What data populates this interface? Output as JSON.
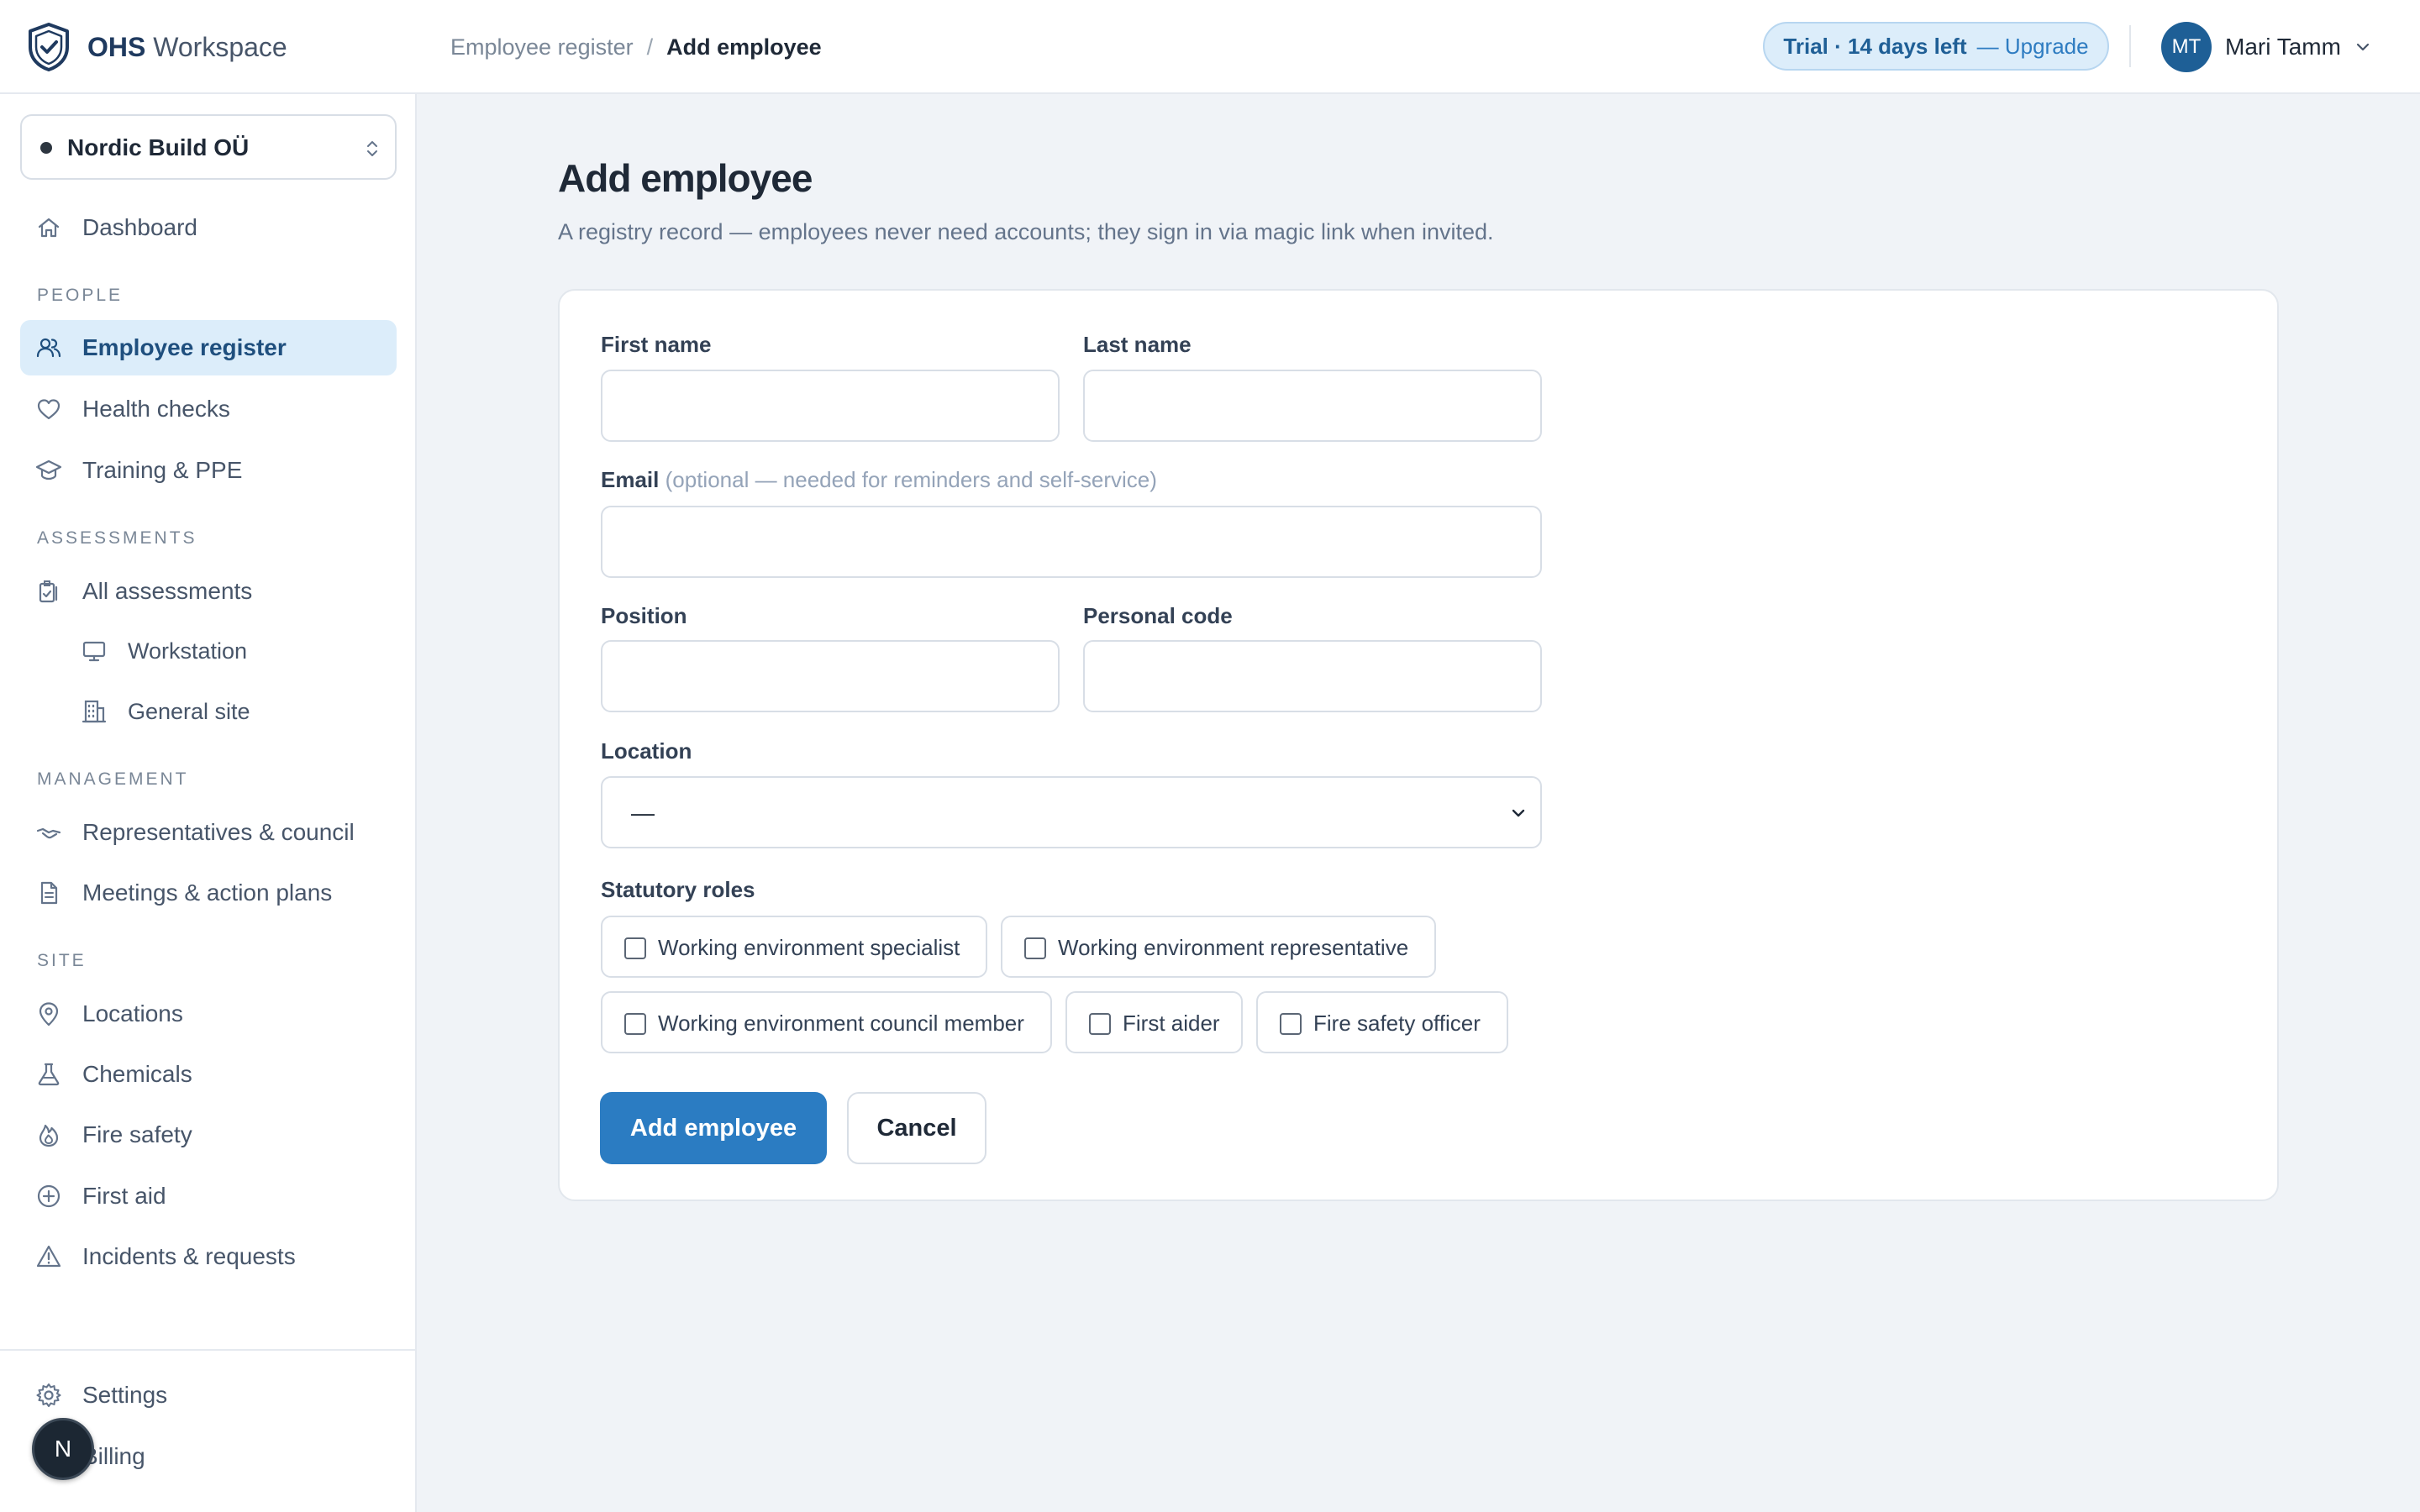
{
  "app": {
    "brand_strong": "OHS",
    "brand_light": "Workspace"
  },
  "breadcrumb": {
    "parent": "Employee register",
    "separator": "/",
    "current": "Add employee"
  },
  "trial": {
    "text": "Trial · 14 days left",
    "upgrade": "— Upgrade"
  },
  "user": {
    "initials": "MT",
    "name": "Mari Tamm"
  },
  "org": {
    "name": "Nordic Build OÜ"
  },
  "sidebar": {
    "dashboard": "Dashboard",
    "section_people": "PEOPLE",
    "employee_register": "Employee register",
    "health_checks": "Health checks",
    "training": "Training & PPE",
    "section_assessments": "ASSESSMENTS",
    "all_assessments": "All assessments",
    "workstation": "Workstation",
    "general_site": "General site",
    "section_management": "MANAGEMENT",
    "representatives": "Representatives & council",
    "meetings": "Meetings & action plans",
    "section_site": "SITE",
    "locations": "Locations",
    "chemicals": "Chemicals",
    "fire_safety": "Fire safety",
    "first_aid": "First aid",
    "incidents": "Incidents & requests",
    "settings": "Settings",
    "billing": "Billing"
  },
  "fab": {
    "initial": "N"
  },
  "page": {
    "title": "Add employee",
    "subtitle": "A registry record — employees never need accounts; they sign in via magic link when invited."
  },
  "form": {
    "first_name_label": "First name",
    "first_name_value": "",
    "last_name_label": "Last name",
    "last_name_value": "",
    "email_label": "Email",
    "email_hint": "(optional — needed for reminders and self-service)",
    "email_value": "",
    "position_label": "Position",
    "position_value": "",
    "personal_code_label": "Personal code",
    "personal_code_value": "",
    "location_label": "Location",
    "location_value": "—",
    "roles_label": "Statutory roles",
    "roles": [
      {
        "label": "Working environment specialist",
        "checked": false
      },
      {
        "label": "Working environment representative",
        "checked": false
      },
      {
        "label": "Working environment council member",
        "checked": false
      },
      {
        "label": "First aider",
        "checked": false
      },
      {
        "label": "Fire safety officer",
        "checked": false
      }
    ],
    "submit_label": "Add employee",
    "cancel_label": "Cancel"
  },
  "colors": {
    "primary": "#2b7cc2",
    "active_nav_bg": "#dcedfa",
    "page_bg": "#f0f3f7"
  }
}
